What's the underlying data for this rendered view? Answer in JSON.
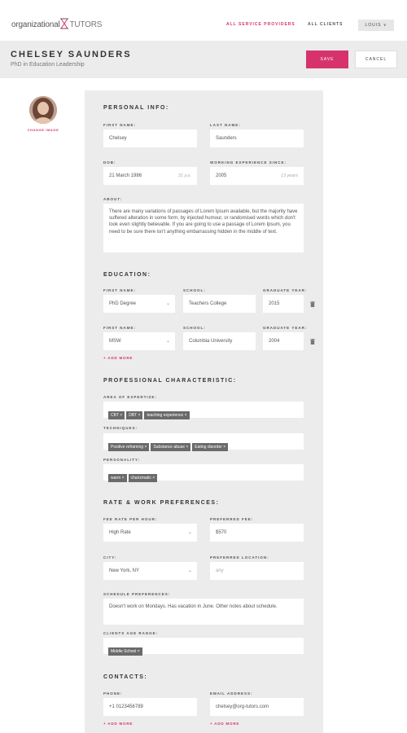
{
  "topbar": {
    "logo_left": "organizational",
    "logo_right": "TUTORS",
    "nav_providers": "ALL SERVICE PROVIDERS",
    "nav_clients": "ALL CLIENTS",
    "user_label": "LOUIS ∨"
  },
  "header": {
    "name": "CHELSEY SAUNDERS",
    "subtitle": "PhD in Education Leadership",
    "save_label": "SAVE",
    "cancel_label": "CANCEL"
  },
  "profile": {
    "change_image": "CHANGE IMAGE"
  },
  "personal": {
    "title": "PERSONAL INFO:",
    "first_name_label": "FIRST NAME:",
    "first_name": "Chelsey",
    "last_name_label": "LAST NAME:",
    "last_name": "Saunders",
    "dob_label": "DOB:",
    "dob": "21 March 1986",
    "dob_hint": "31 y.o.",
    "exp_label": "WORKING EXPERIENCE SINCE:",
    "exp": "2005",
    "exp_hint": "13 years",
    "about_label": "ABOUT:",
    "about": "There are many variations of passages of Lorem Ipsum available, but the majority have suffered alteration in some form, by injected humour, or randomised words which don't look even slightly believable. If you are going to use a passage of Lorem Ipsum, you need to be sure there isn't anything embarrassing hidden in the middle of text."
  },
  "education": {
    "title": "EDUCATION:",
    "rows": [
      {
        "first_name_label": "FIRST NAME:",
        "degree": "PhD Degree",
        "school_label": "SCHOOL:",
        "school": "Teachers College",
        "year_label": "GRADUATE YEAR:",
        "year": "2015"
      },
      {
        "first_name_label": "FIRST NAME:",
        "degree": "MSW",
        "school_label": "SCHOOL:",
        "school": "Columbia University",
        "year_label": "GRADUATE YEAR:",
        "year": "2004"
      }
    ],
    "add_more": "+ ADD MORE"
  },
  "professional": {
    "title": "PROFESSIONAL CHARACTERISTIC:",
    "expertise_label": "AREA OF EXPERTIZE:",
    "expertise": [
      "CBT ×",
      "DBT ×",
      "teaching experience ×"
    ],
    "techniques_label": "TECHNIQUES:",
    "techniques": [
      "Positive reframing ×",
      "Substance abuse ×",
      "Eating disorder ×"
    ],
    "personality_label": "PERSONALITY:",
    "personality": [
      "warm ×",
      "charizmatic ×"
    ]
  },
  "rate": {
    "title": "RATE & WORK PREFERENCES:",
    "fee_rate_label": "FEE RATE PER HOUR:",
    "fee_rate": "High Rate",
    "preferred_fee_label": "PREFERRED FEE:",
    "preferred_fee": "$570",
    "city_label": "CITY:",
    "city": "New York, NY",
    "location_label": "PREFERRED LOCATION:",
    "location_placeholder": "any",
    "schedule_label": "SCHEDULE PREFERENCES:",
    "schedule": "Doesn't work on Mondays. Has vacation in June. Other notes about schedule.",
    "age_label": "CLIENTS AGE RANGE:",
    "age_tags": [
      "Middle School ×"
    ]
  },
  "contacts": {
    "title": "CONTACTS:",
    "phone_label": "PHONE:",
    "phone": "+1 0123456789",
    "email_label": "EMAIL ADDRESS:",
    "email": "chelsey@org-tutors.com",
    "add_phone": "+ ADD MORE",
    "add_email": "+ ADD MORE"
  },
  "colors": {
    "accent": "#d6336c",
    "card_bg": "#ececec",
    "tag_bg": "#6a6a6a"
  }
}
